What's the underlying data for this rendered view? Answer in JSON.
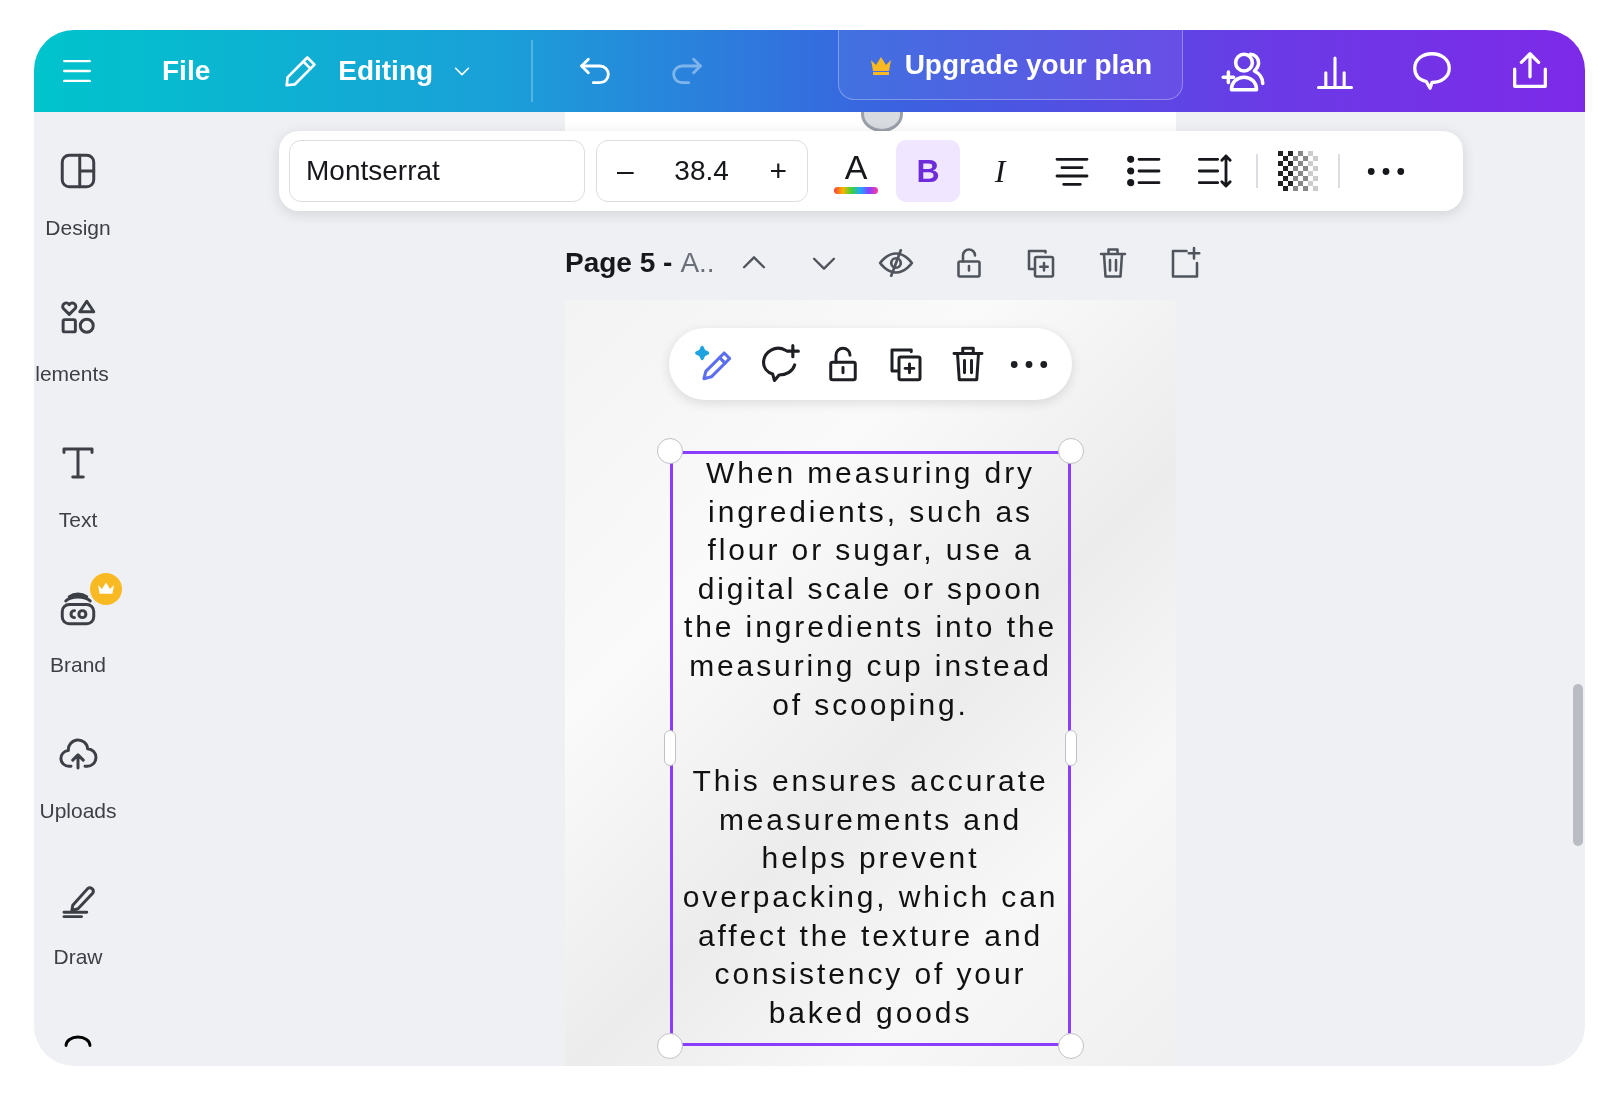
{
  "topbar": {
    "file": "File",
    "mode": "Editing",
    "undo": {
      "disabled": false
    },
    "redo": {
      "disabled": true
    },
    "upgrade": "Upgrade your plan"
  },
  "sidebar": {
    "items": [
      {
        "label": "Design",
        "premium": false
      },
      {
        "label": "lements",
        "premium": false
      },
      {
        "label": "Text",
        "premium": false
      },
      {
        "label": "Brand",
        "premium": true
      },
      {
        "label": "Uploads",
        "premium": false
      },
      {
        "label": "Draw",
        "premium": false
      }
    ]
  },
  "text_toolbar": {
    "font": "Montserrat",
    "decrease": "–",
    "size": "38.4",
    "increase": "+",
    "color_letter": "A",
    "bold": {
      "label": "B",
      "selected": true
    },
    "italic": {
      "label": "I",
      "selected": false
    }
  },
  "page_header": {
    "title": "Page 5 -",
    "subtitle": "A.."
  },
  "text_box": {
    "selected": true,
    "paragraphs": [
      "When measuring dry ingredients, such as flour or sugar, use a digital scale or spoon the ingredients into the measuring cup instead of scooping.",
      "This ensures accurate measurements and helps prevent overpacking, which can affect the texture and consistency of your baked goods"
    ]
  }
}
